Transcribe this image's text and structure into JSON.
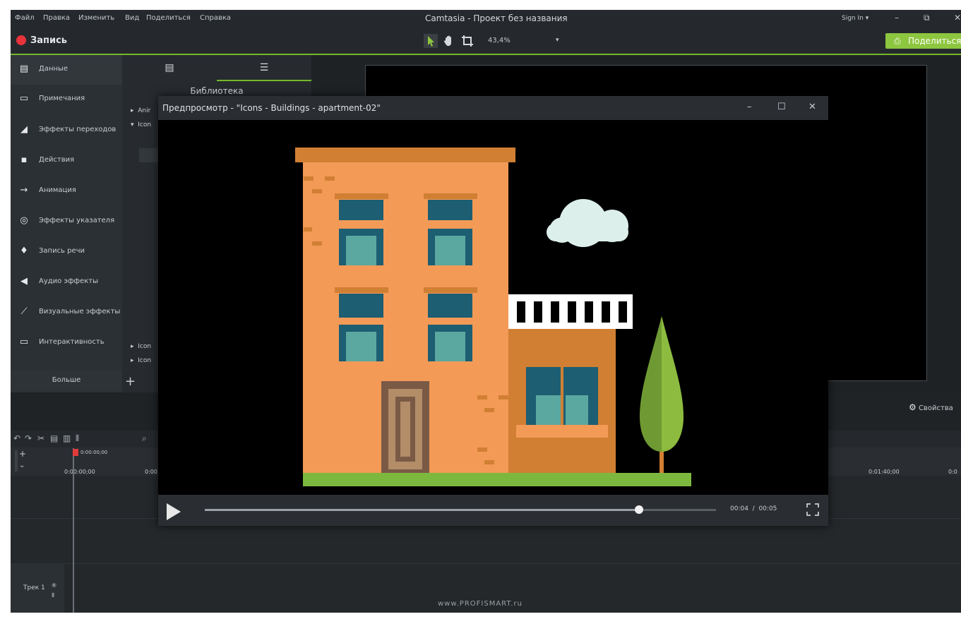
{
  "menu": [
    "Файл",
    "Правка",
    "Изменить",
    "Вид",
    "Поделиться",
    "Справка"
  ],
  "window_title": "Camtasia - Проект без названия",
  "sign_in": "Sign In ▾",
  "window_controls": {
    "minimize": "–",
    "restore": "⧉",
    "close": "✕"
  },
  "toolbar": {
    "record_label": "Запись",
    "zoom": "43,4%",
    "zoom_arrow": "▾",
    "share_label": "Поделиться",
    "accent_color": "#8dc63f"
  },
  "sidebar": {
    "items": [
      {
        "label": "Данные",
        "icon": "media-icon"
      },
      {
        "label": "Примечания",
        "icon": "annotation-icon"
      },
      {
        "label": "Эффекты переходов",
        "icon": "transition-icon"
      },
      {
        "label": "Действия",
        "icon": "behavior-icon"
      },
      {
        "label": "Анимация",
        "icon": "animation-icon"
      },
      {
        "label": "Эффекты указателя",
        "icon": "cursor-effect-icon"
      },
      {
        "label": "Запись речи",
        "icon": "microphone-icon"
      },
      {
        "label": "Аудио эффекты",
        "icon": "speaker-icon"
      },
      {
        "label": "Визуальные эффекты",
        "icon": "magic-wand-icon"
      },
      {
        "label": "Интерактивность",
        "icon": "interactivity-icon"
      }
    ],
    "more_label": "Больше"
  },
  "library": {
    "title": "Библиотека",
    "rows": [
      "Anir",
      "Icon",
      "Icon",
      "Icon"
    ],
    "add_label": "+"
  },
  "properties_label": "Свойства",
  "timeline": {
    "playhead_time": "0:00:00;00",
    "ruler_labels": [
      "0:00:00;00",
      "0:00",
      "0:01:40;00",
      "0:0"
    ],
    "track_label": "Трек 1"
  },
  "watermark": "www.PROFISMART.ru",
  "preview": {
    "title": "Предпросмотр - \"Icons - Buildings - apartment-02\"",
    "current_time": "00:04",
    "separator": "/",
    "total_time": "00:05",
    "progress_fraction": 0.85
  }
}
